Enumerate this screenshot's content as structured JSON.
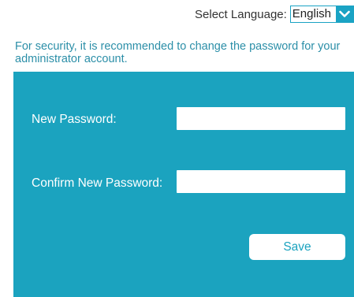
{
  "language": {
    "label": "Select Language:",
    "selected": "English"
  },
  "notice": {
    "text": "For security, it is recommended to change the password for your administrator account."
  },
  "form": {
    "new_password_label": "New Password:",
    "new_password_value": "",
    "confirm_password_label": "Confirm New Password:",
    "confirm_password_value": "",
    "save_label": "Save"
  },
  "colors": {
    "panel": "#1ba3bf",
    "accent": "#1aa3c4",
    "notice_text": "#2c8fa8"
  },
  "icons": {
    "language_dropdown": "chevron-down-icon"
  }
}
